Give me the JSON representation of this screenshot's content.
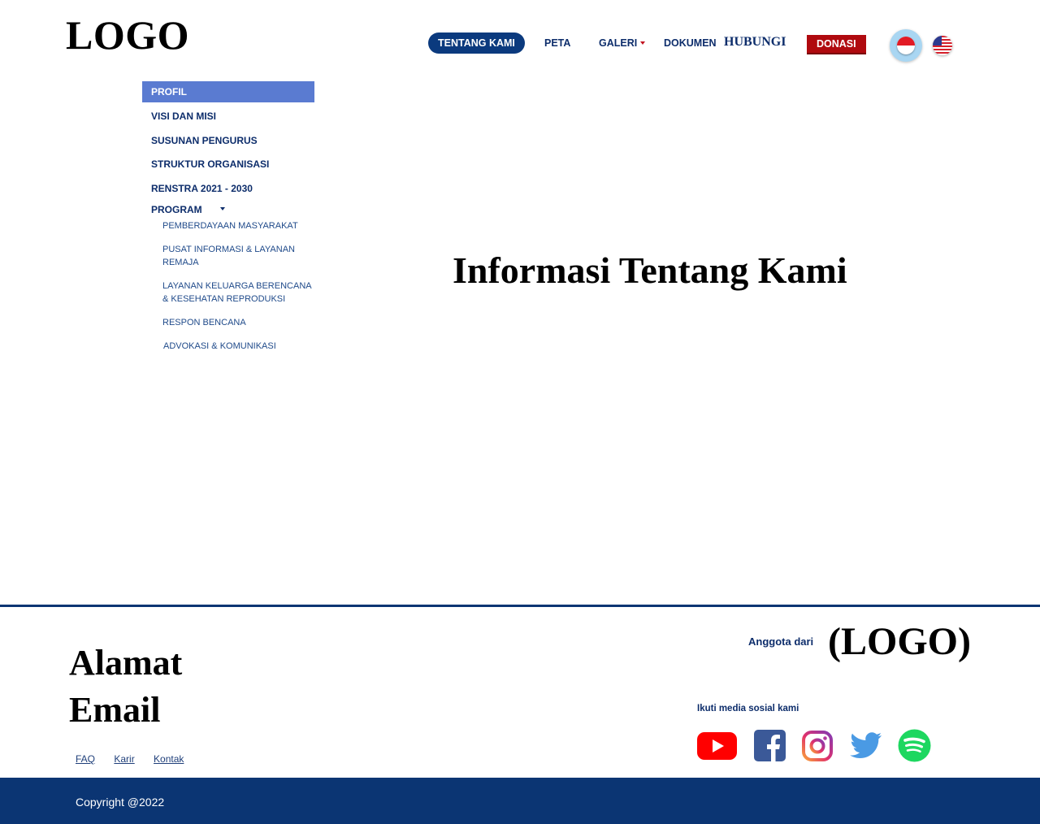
{
  "header": {
    "logo": "LOGO",
    "nav": [
      {
        "label": "TENTANG KAMI",
        "active": true
      },
      {
        "label": "PETA"
      },
      {
        "label": "GALERI",
        "dropdown": true
      },
      {
        "label": "DOKUMEN"
      },
      {
        "label": "HUBUNGI"
      },
      {
        "label": "DONASI"
      }
    ],
    "languages": [
      "id-flag-icon",
      "us-flag-icon"
    ]
  },
  "sidebar": {
    "items": [
      {
        "label": "PROFIL",
        "active": true
      },
      {
        "label": "VISI DAN MISI"
      },
      {
        "label": "SUSUNAN PENGURUS"
      },
      {
        "label": "STRUKTUR ORGANISASI"
      },
      {
        "label": "RENSTRA 2021 - 2030"
      },
      {
        "label": "PROGRAM"
      }
    ],
    "program_subitems": [
      {
        "label": "PEMBERDAYAAN MASYARAKAT"
      },
      {
        "label": "PUSAT INFORMASI & LAYANAN REMAJA"
      },
      {
        "label": "LAYANAN KELUARGA BERENCANA & KESEHATAN REPRODUKSI"
      },
      {
        "label": "RESPON BENCANA"
      },
      {
        "label": "ADVOKASI & KOMUNIKASI"
      }
    ]
  },
  "main": {
    "title": "Informasi Tentang Kami"
  },
  "footer": {
    "alamat": "Alamat",
    "email": "Email",
    "links": [
      {
        "label": "FAQ"
      },
      {
        "label": "Karir"
      },
      {
        "label": "Kontak"
      }
    ],
    "anggota_label": "Anggota dari",
    "partner_logo": "(LOGO)",
    "social_label": "Ikuti media sosial kami",
    "social": [
      "youtube-icon",
      "facebook-icon",
      "instagram-icon",
      "twitter-icon",
      "spotify-icon"
    ],
    "copyright": "Copyright @2022"
  },
  "colors": {
    "primary": "#0b3573",
    "accent_red": "#b00a0f",
    "sidebar_active": "#5a7bd1"
  }
}
